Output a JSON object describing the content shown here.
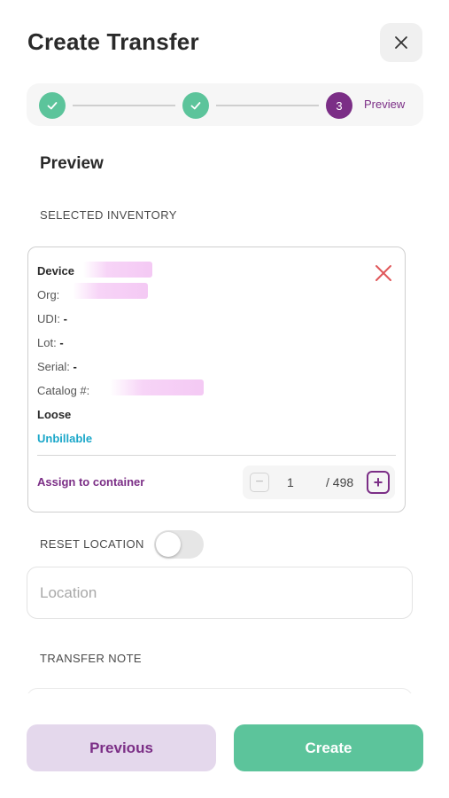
{
  "header": {
    "title": "Create Transfer",
    "close_icon": "close-icon"
  },
  "stepper": {
    "steps": [
      {
        "status": "complete",
        "icon": "check-icon"
      },
      {
        "status": "complete",
        "icon": "check-icon"
      },
      {
        "status": "current",
        "number": "3",
        "label": "Preview"
      }
    ],
    "complete_color": "#5cc49b",
    "current_color": "#7b2e86"
  },
  "main": {
    "heading": "Preview",
    "selected_inventory_label": "SELECTED INVENTORY",
    "item": {
      "device_label": "Device",
      "org_label": "Org:",
      "udi_label": "UDI:",
      "udi_value": "-",
      "lot_label": "Lot:",
      "lot_value": "-",
      "serial_label": "Serial:",
      "serial_value": "-",
      "catalog_label": "Catalog #:",
      "status": "Loose",
      "billing": "Unbillable",
      "remove_icon": "close-icon",
      "assign_label": "Assign to container",
      "quantity": {
        "value": "1",
        "total": "/ 498",
        "minus": "−",
        "plus": "+"
      }
    },
    "reset_location_label": "RESET LOCATION",
    "reset_location_on": false,
    "location_placeholder": "Location",
    "transfer_note_label": "TRANSFER NOTE"
  },
  "footer": {
    "previous_label": "Previous",
    "create_label": "Create"
  },
  "colors": {
    "accent_purple": "#7b2e86",
    "accent_green": "#5cc49b",
    "billing_cyan": "#1aa7c9",
    "remove_red": "#e0575a"
  }
}
